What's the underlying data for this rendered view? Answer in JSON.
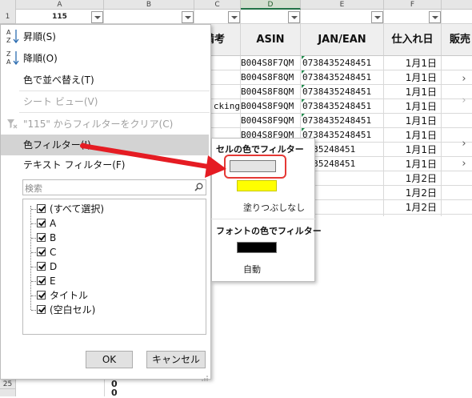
{
  "sheet": {
    "columns": [
      {
        "letter": "A",
        "header": "115",
        "selected": false
      },
      {
        "letter": "B",
        "header": "",
        "selected": false
      },
      {
        "letter": "C",
        "header": "備考",
        "selected": false
      },
      {
        "letter": "D",
        "header": "ASIN",
        "selected": true
      },
      {
        "letter": "E",
        "header": "JAN/EAN",
        "selected": false
      },
      {
        "letter": "F",
        "header": "仕入れ日",
        "selected": false
      },
      {
        "letter": "",
        "header": "販売",
        "selected": false
      }
    ],
    "row_numbers": [
      "1",
      "25"
    ],
    "c_cell_partial": "cking",
    "rows": [
      {
        "asin": "B004S8F7QM",
        "jan": "0738435248451",
        "date": "1月1日"
      },
      {
        "asin": "B004S8F8QM",
        "jan": "0738435248451",
        "date": "1月1日"
      },
      {
        "asin": "B004S8F8QM",
        "jan": "0738435248451",
        "date": "1月1日"
      },
      {
        "asin": "B004S8F9QM",
        "jan": "0738435248451",
        "date": "1月1日"
      },
      {
        "asin": "B004S8F9QM",
        "jan": "0738435248451",
        "date": "1月1日"
      },
      {
        "asin": "B004S8F9QM",
        "jan": "0738435248451",
        "date": "1月1日"
      },
      {
        "asin": "",
        "jan": "8435248451",
        "date": "1月1日"
      },
      {
        "asin": "",
        "jan": "8435248451",
        "date": "1月1日"
      },
      {
        "asin": "",
        "jan": "",
        "date": "1月2日"
      },
      {
        "asin": "",
        "jan": "",
        "date": "1月2日"
      },
      {
        "asin": "",
        "jan": "",
        "date": "1月2日"
      }
    ],
    "bottom_cells": [
      "0",
      "0"
    ]
  },
  "menu": {
    "sort_asc": "昇順(S)",
    "sort_desc": "降順(O)",
    "sort_by_color": "色で並べ替え(T)",
    "sheet_view": "シート ビュー(V)",
    "clear_filter": "\"115\" からフィルターをクリア(C)",
    "color_filter": "色フィルター(I)",
    "text_filter": "テキスト フィルター(F)",
    "search_placeholder": "検索",
    "items": [
      "(すべて選択)",
      "A",
      "B",
      "C",
      "D",
      "E",
      "タイトル",
      "(空白セル)"
    ],
    "ok": "OK",
    "cancel": "キャンセル",
    "icons": {
      "sort_asc": "A↓Z",
      "sort_desc": "Z↓A"
    }
  },
  "submenu": {
    "cell_color_header": "セルの色でフィルター",
    "no_fill": "塗りつぶしなし",
    "font_color_header": "フォントの色でフィルター",
    "auto": "自動",
    "swatches": {
      "gray": "#e4e4e4",
      "yellow": "#ffff00",
      "black": "#000000"
    }
  },
  "colors": {
    "highlight": "#e53935",
    "arrow": "#e51c23",
    "excel_green": "#217346"
  }
}
